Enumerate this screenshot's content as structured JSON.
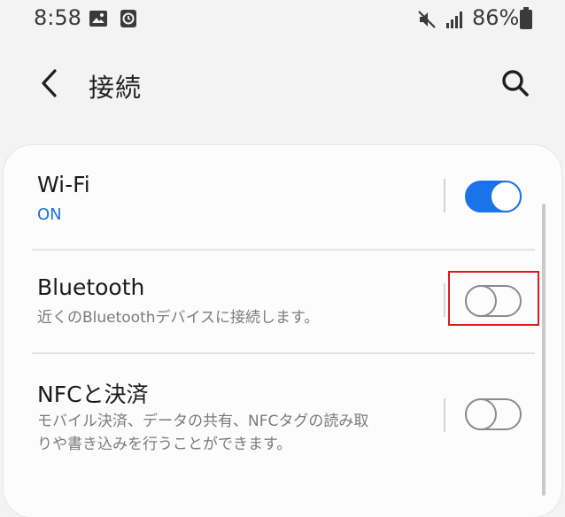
{
  "status_bar": {
    "time": "8:58",
    "battery": "86%",
    "icons": [
      "gallery-icon",
      "clock-icon",
      "mute-icon",
      "signal-icon",
      "battery-icon"
    ]
  },
  "header": {
    "title": "接続",
    "back_icon": "back-arrow-icon",
    "search_icon": "search-icon"
  },
  "settings": [
    {
      "key": "wifi",
      "title": "Wi-Fi",
      "subtitle": "ON",
      "enabled": true
    },
    {
      "key": "bluetooth",
      "title": "Bluetooth",
      "subtitle": "近くのBluetoothデバイスに接続します。",
      "enabled": false
    },
    {
      "key": "nfc",
      "title": "NFCと決済",
      "subtitle_line1": "モバイル決済、データの共有、NFCタグの読み取",
      "subtitle_line2": "りや書き込みを行うことができます。",
      "enabled": false
    }
  ],
  "colors": {
    "accent": "#1a73e8",
    "on_text": "#1a73d9",
    "highlight": "#e01a1a",
    "background": "#f3f3f3",
    "card": "#fcfcfc"
  }
}
